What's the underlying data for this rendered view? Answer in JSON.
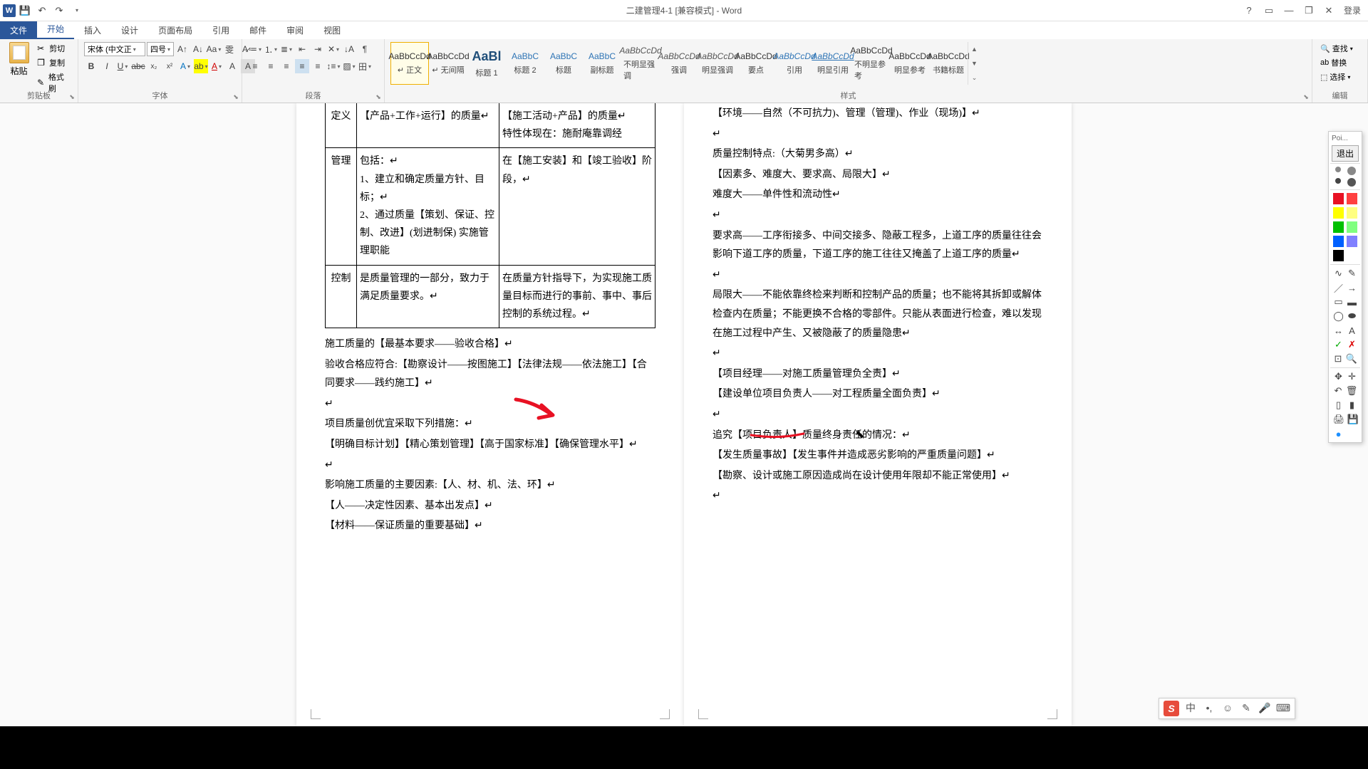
{
  "titlebar": {
    "doc_title": "二建管理4-1 [兼容模式] - Word",
    "login": "登录"
  },
  "tabs": {
    "file": "文件",
    "home": "开始",
    "insert": "插入",
    "design": "设计",
    "layout": "页面布局",
    "ref": "引用",
    "mail": "邮件",
    "review": "审阅",
    "view": "视图"
  },
  "ribbon": {
    "clipboard": {
      "label": "剪贴板",
      "paste": "粘贴",
      "cut": "剪切",
      "copy": "复制",
      "fmt": "格式刷"
    },
    "font": {
      "label": "字体",
      "name": "宋体 (中文正",
      "size": "四号"
    },
    "para": {
      "label": "段落"
    },
    "styles": {
      "label": "样式",
      "items": [
        {
          "preview": "AaBbCcDd",
          "name": "↵ 正文",
          "cls": ""
        },
        {
          "preview": "AaBbCcDd",
          "name": "↵ 无间隔",
          "cls": ""
        },
        {
          "preview": "AaBl",
          "name": "标题 1",
          "cls": "big"
        },
        {
          "preview": "AaBbC",
          "name": "标题 2",
          "cls": "blue"
        },
        {
          "preview": "AaBbC",
          "name": "标题",
          "cls": "blue"
        },
        {
          "preview": "AaBbC",
          "name": "副标题",
          "cls": "blue"
        },
        {
          "preview": "AaBbCcDd",
          "name": "不明显强调",
          "cls": "em"
        },
        {
          "preview": "AaBbCcDd",
          "name": "强调",
          "cls": "em"
        },
        {
          "preview": "AaBbCcDd",
          "name": "明显强调",
          "cls": "em"
        },
        {
          "preview": "AaBbCcDd",
          "name": "要点",
          "cls": ""
        },
        {
          "preview": "AaBbCcDd",
          "name": "引用",
          "cls": "ref"
        },
        {
          "preview": "AaBbCcDd",
          "name": "明显引用",
          "cls": "ref u"
        },
        {
          "preview": "AaBbCcDd",
          "name": "不明显参考",
          "cls": ""
        },
        {
          "preview": "AaBbCcDd",
          "name": "明显参考",
          "cls": ""
        },
        {
          "preview": "AaBbCcDd",
          "name": "书籍标题",
          "cls": ""
        }
      ]
    },
    "edit": {
      "label": "编辑",
      "find": "查找",
      "replace": "替换",
      "select": "选择"
    }
  },
  "left_page": {
    "table": [
      {
        "h": "定义",
        "c1": "【产品+工作+运行】的质量↵",
        "c2": "【施工活动+产品】的质量↵\n特性体现在：施耐庵靠调经"
      },
      {
        "h": "管理",
        "c1": "包括：↵\n1、建立和确定质量方针、目标；↵\n2、通过质量【策划、保证、控制、改进】(划进制保) 实施管理职能",
        "c2": "在【施工安装】和【竣工验收】阶段，↵"
      },
      {
        "h": "控制",
        "c1": "是质量管理的一部分，致力于满足质量要求。↵",
        "c2": "在质量方针指导下，为实现施工质量目标而进行的事前、事中、事后控制的系统过程。↵"
      }
    ],
    "paras": [
      "施工质量的【最基本要求——验收合格】↵",
      "验收合格应符合:【勘察设计——按图施工】【法律法规——依法施工】【合同要求——践约施工】↵",
      "↵",
      "项目质量创优宜采取下列措施：↵",
      "【明确目标计划】【精心策划管理】【高于国家标准】【确保管理水平】↵",
      "↵",
      "影响施工质量的主要因素:【人、材、机、法、环】↵",
      "【人——决定性因素、基本出发点】↵",
      "【材料——保证质量的重要基础】↵"
    ]
  },
  "right_page": {
    "paras": [
      "【环境——自然（不可抗力)、管理（管理)、作业（现场)】↵",
      "↵",
      "质量控制特点:（大菊男多高）↵",
      "【因素多、难度大、要求高、局限大】↵",
      "难度大——单件性和流动性↵",
      "↵",
      "要求高——工序衔接多、中间交接多、隐蔽工程多，上道工序的质量往往会影响下道工序的质量，下道工序的施工往往又掩盖了上道工序的质量↵",
      "↵",
      "局限大——不能依靠终检来判断和控制产品的质量；也不能将其拆卸或解体检查内在质量；不能更换不合格的零部件。只能从表面进行检查，难以发现在施工过程中产生、又被隐蔽了的质量隐患↵",
      "↵",
      "【项目经理——对施工质量管理负全责】↵",
      "【建设单位项目负责人——对工程质量全面负责】↵",
      "↵",
      "追究【项目负责人】质量终身责任的情况：↵",
      "【发生质量事故】【发生事件并造成恶劣影响的严重质量问题】↵",
      "【勘察、设计或施工原因造成尚在设计使用年限却不能正常使用】↵",
      "↵"
    ]
  },
  "ann": {
    "title": "Poi...",
    "exit": "退出",
    "colors": [
      "#e81123",
      "#ff4040",
      "#ffff00",
      "#ffff80",
      "#00c000",
      "#80ff80",
      "#0060ff",
      "#8080ff",
      "#000000"
    ]
  }
}
